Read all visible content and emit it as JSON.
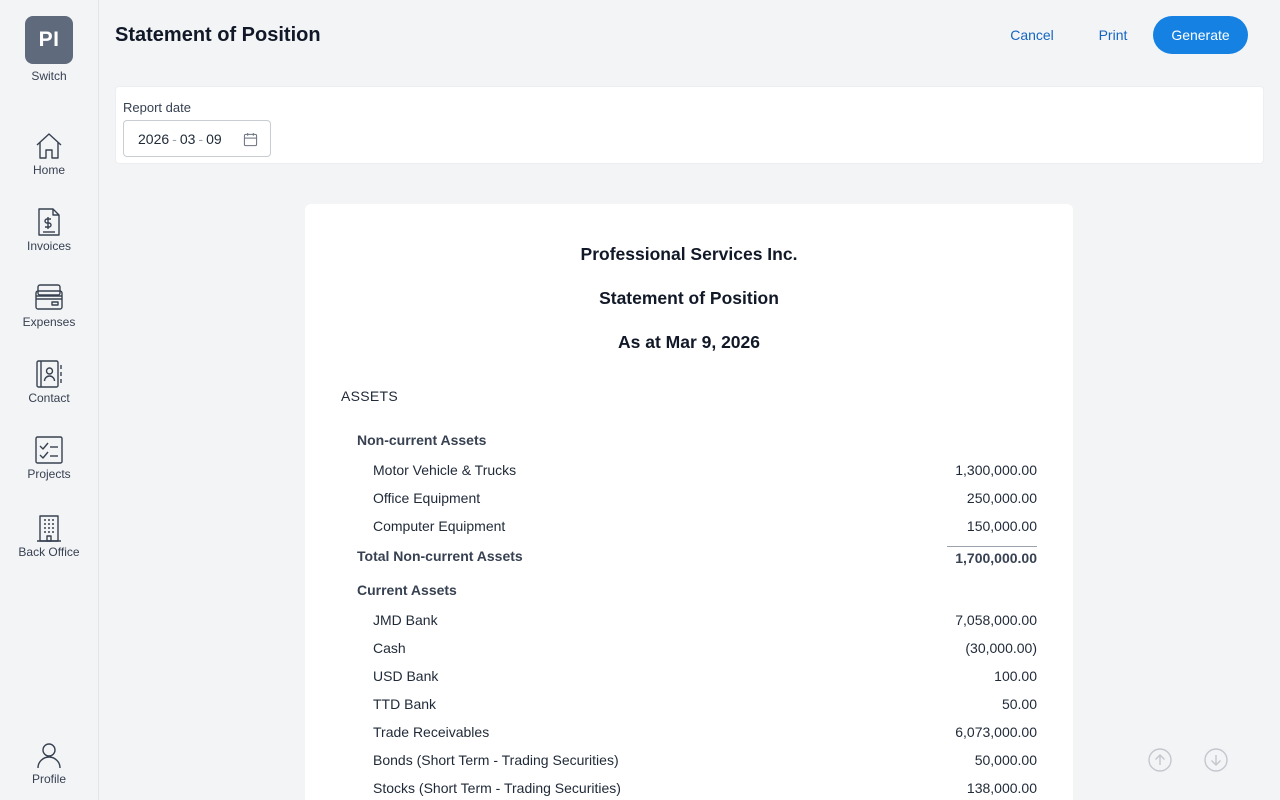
{
  "sidebar": {
    "switch": {
      "initials": "PI",
      "label": "Switch"
    },
    "items": [
      {
        "label": "Home",
        "icon": "home-icon"
      },
      {
        "label": "Invoices",
        "icon": "invoice-icon"
      },
      {
        "label": "Expenses",
        "icon": "credit-card-icon"
      },
      {
        "label": "Contact",
        "icon": "contact-book-icon"
      },
      {
        "label": "Projects",
        "icon": "checklist-icon"
      },
      {
        "label": "Back Office",
        "icon": "office-building-icon"
      }
    ],
    "profile": {
      "label": "Profile",
      "icon": "user-icon"
    }
  },
  "header": {
    "title": "Statement of Position",
    "cancel_label": "Cancel",
    "print_label": "Print",
    "generate_label": "Generate"
  },
  "filter": {
    "label": "Report date",
    "year": "2026",
    "month": "03",
    "day": "09",
    "sep": "-"
  },
  "report": {
    "company": "Professional Services Inc.",
    "title": "Statement of Position",
    "as_at": "As at Mar 9, 2026",
    "section_assets": "ASSETS",
    "noncurrent": {
      "title": "Non-current Assets",
      "rows": [
        {
          "name": "Motor Vehicle & Trucks",
          "amount": "1,300,000.00"
        },
        {
          "name": "Office Equipment",
          "amount": "250,000.00"
        },
        {
          "name": "Computer Equipment",
          "amount": "150,000.00"
        }
      ],
      "total_label": "Total Non-current Assets",
      "total_amount": "1,700,000.00"
    },
    "current": {
      "title": "Current Assets",
      "rows": [
        {
          "name": "JMD Bank",
          "amount": "7,058,000.00"
        },
        {
          "name": "Cash",
          "amount": "(30,000.00)"
        },
        {
          "name": "USD Bank",
          "amount": "100.00"
        },
        {
          "name": "TTD Bank",
          "amount": "50.00"
        },
        {
          "name": "Trade Receivables",
          "amount": "6,073,000.00"
        },
        {
          "name": "Bonds (Short Term - Trading Securities)",
          "amount": "50,000.00"
        },
        {
          "name": "Stocks (Short Term - Trading Securities)",
          "amount": "138,000.00"
        }
      ]
    }
  },
  "scroll": {
    "up_icon": "arrow-up-circle-icon",
    "down_icon": "arrow-down-circle-icon"
  }
}
